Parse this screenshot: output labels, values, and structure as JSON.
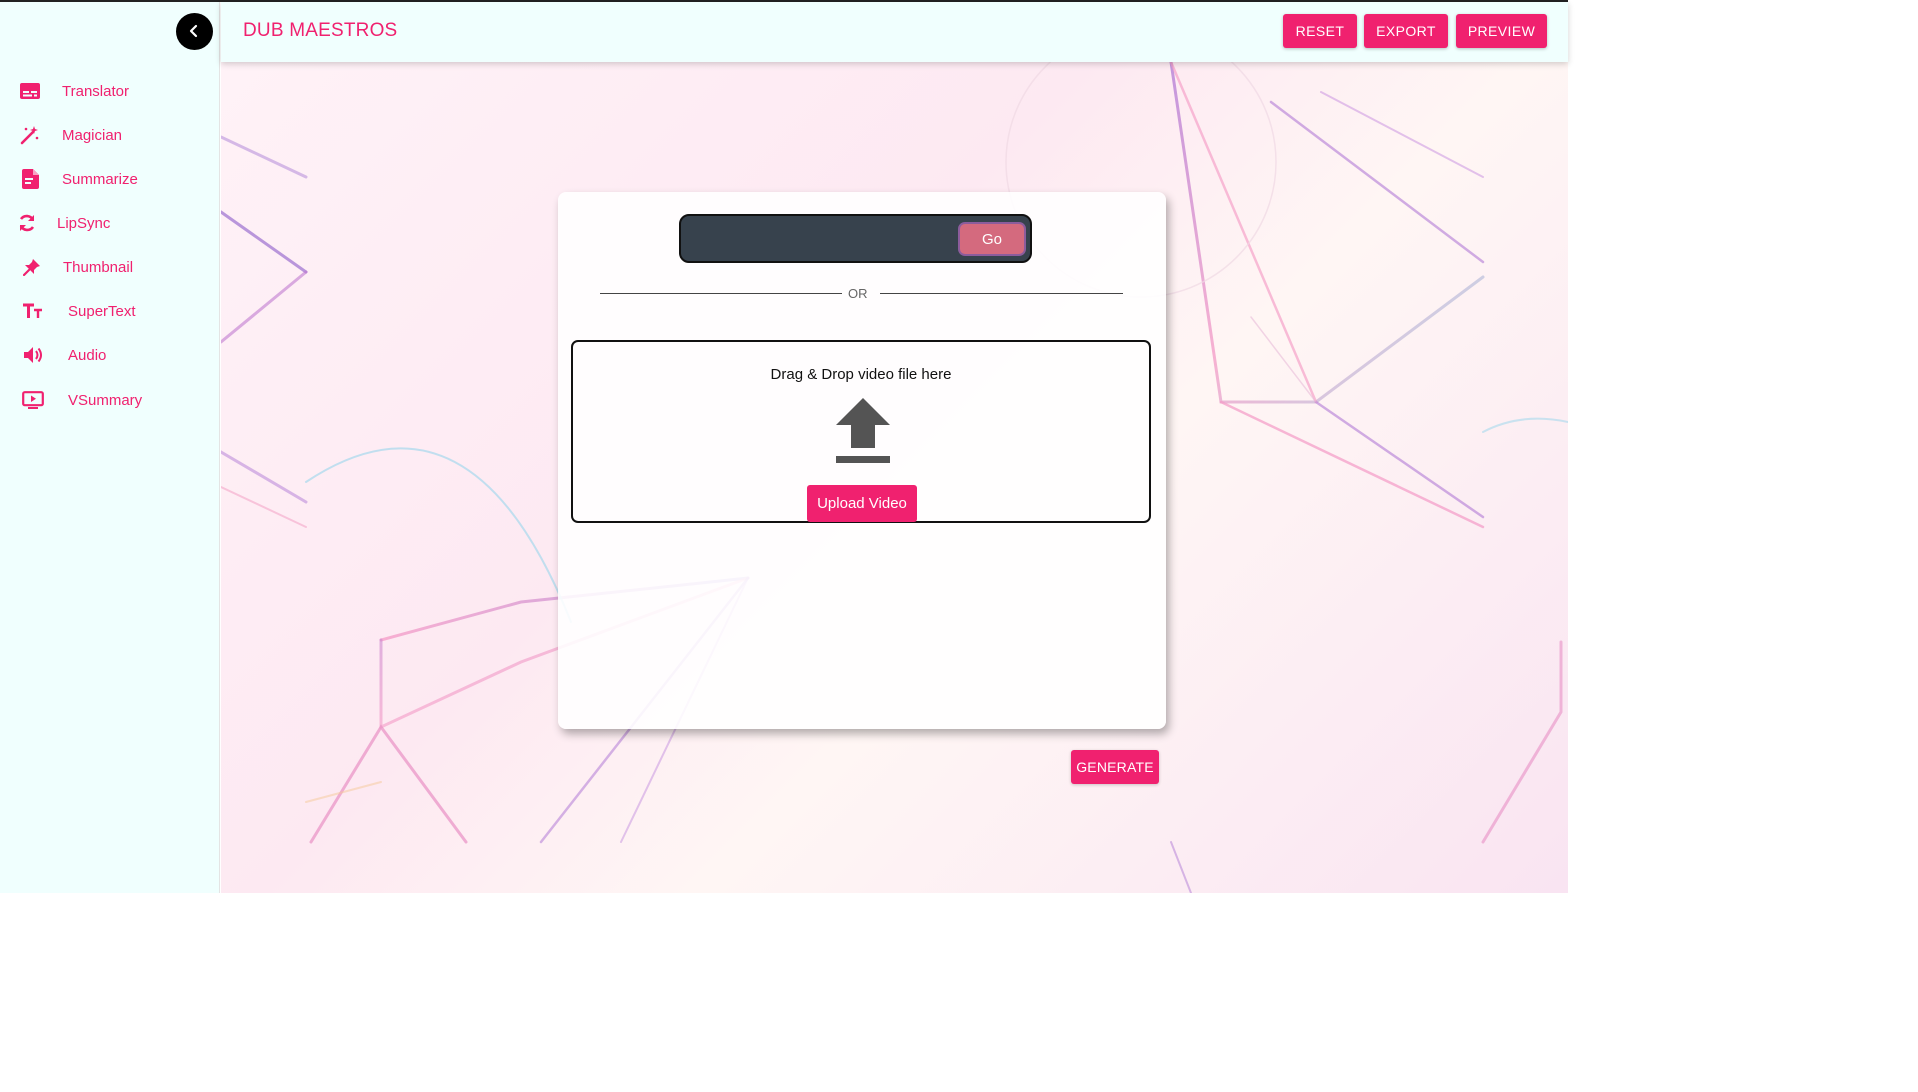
{
  "app": {
    "title": "DUB MAESTROS"
  },
  "header": {
    "buttons": {
      "reset": "RESET",
      "export": "EXPORT",
      "preview": "PREVIEW"
    }
  },
  "sidebar": {
    "items": [
      {
        "label": "Translator",
        "icon": "subtitles-icon"
      },
      {
        "label": "Magician",
        "icon": "magic-wand-icon"
      },
      {
        "label": "Summarize",
        "icon": "summary-doc-icon"
      },
      {
        "label": "LipSync",
        "icon": "sync-icon"
      },
      {
        "label": "Thumbnail",
        "icon": "pin-icon"
      },
      {
        "label": "SuperText",
        "icon": "text-size-icon"
      },
      {
        "label": "Audio",
        "icon": "speaker-icon"
      },
      {
        "label": "VSummary",
        "icon": "video-play-icon"
      }
    ]
  },
  "card": {
    "url_input_value": "",
    "go_label": "Go",
    "or_label": "OR",
    "drop_text": "Drag & Drop video file here",
    "upload_label": "Upload Video"
  },
  "actions": {
    "generate_label": "GENERATE"
  },
  "colors": {
    "accent": "#f0216f",
    "sidebar_bg": "#f0fffe",
    "go_button": "#d46a7e",
    "input_bg": "#37424d"
  }
}
